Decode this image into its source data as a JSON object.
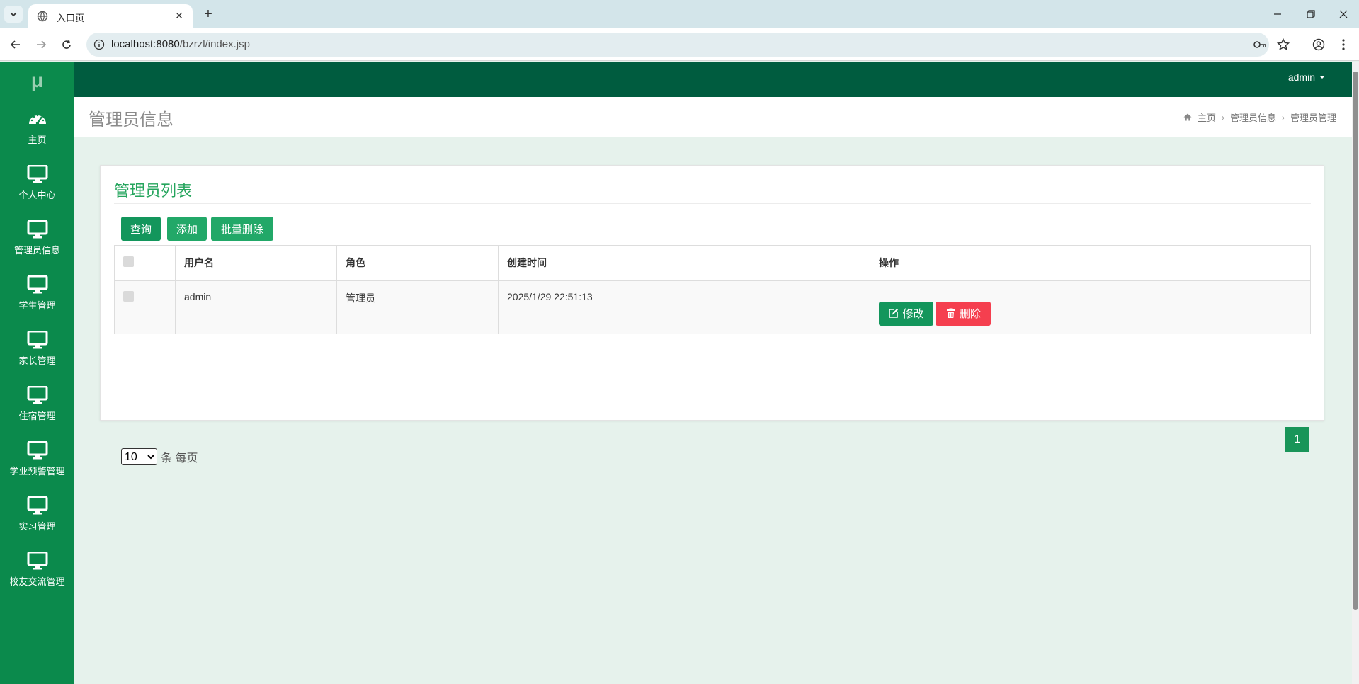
{
  "browser": {
    "tab_title": "入口页",
    "url_host": "localhost:8080",
    "url_path": "/bzrzl/index.jsp"
  },
  "app": {
    "logo": "μ",
    "user": "admin"
  },
  "sidebar": {
    "items": [
      {
        "label": "主页",
        "icon": "dashboard-icon"
      },
      {
        "label": "个人中心",
        "icon": "monitor-icon"
      },
      {
        "label": "管理员信息",
        "icon": "monitor-icon"
      },
      {
        "label": "学生管理",
        "icon": "monitor-icon"
      },
      {
        "label": "家长管理",
        "icon": "monitor-icon"
      },
      {
        "label": "住宿管理",
        "icon": "monitor-icon"
      },
      {
        "label": "学业预警管理",
        "icon": "monitor-icon"
      },
      {
        "label": "实习管理",
        "icon": "monitor-icon"
      },
      {
        "label": "校友交流管理",
        "icon": "monitor-icon"
      }
    ]
  },
  "header": {
    "title": "管理员信息",
    "breadcrumb": [
      "主页",
      "管理员信息",
      "管理员管理"
    ]
  },
  "card": {
    "title": "管理员列表",
    "buttons": {
      "query": "查询",
      "add": "添加",
      "batch_delete": "批量删除"
    },
    "columns": [
      "用户名",
      "角色",
      "创建时间",
      "操作"
    ],
    "rows": [
      {
        "username": "admin",
        "role": "管理员",
        "created": "2025/1/29 22:51:13",
        "edit": "修改",
        "delete": "删除"
      }
    ],
    "per_page": {
      "value": "10",
      "label": "条 每页"
    },
    "current_page": "1"
  },
  "colors": {
    "sidebar": "#0b8a4c",
    "topbar": "#005c3f",
    "accent": "#25a55d",
    "danger": "#f53f4f"
  }
}
